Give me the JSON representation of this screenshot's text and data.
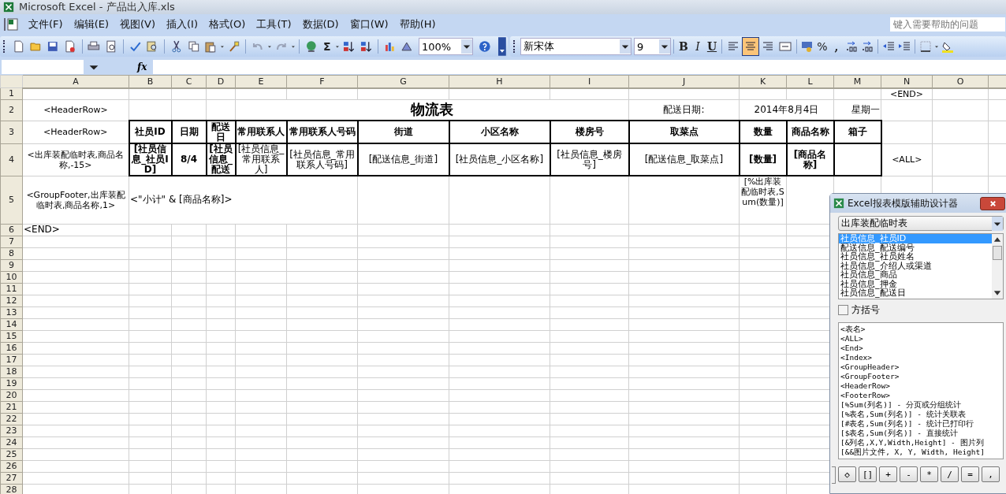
{
  "window": {
    "title": "Microsoft Excel - 产品出入库.xls"
  },
  "menu": [
    "文件(F)",
    "编辑(E)",
    "视图(V)",
    "插入(I)",
    "格式(O)",
    "工具(T)",
    "数据(D)",
    "窗口(W)",
    "帮助(H)"
  ],
  "help_search": {
    "placeholder": "键入需要帮助的问题"
  },
  "standard_toolbar": {
    "sum_label": "Σ",
    "zoom": "100%"
  },
  "formatting_toolbar": {
    "font": "新宋体",
    "size": "9",
    "bold_label": "B",
    "italic_label": "I",
    "underline_label": "U",
    "align_buttons": [
      {
        "selected": false
      },
      {
        "selected": true
      },
      {
        "selected": false
      },
      {
        "selected": false
      }
    ],
    "percent_label": "%",
    "comma_label": ","
  },
  "formula_bar": {
    "fx_label": "fx"
  },
  "sheet": {
    "columns": [
      "A",
      "B",
      "C",
      "D",
      "E",
      "F",
      "G",
      "H",
      "I",
      "J",
      "K",
      "L",
      "M",
      "N",
      "O"
    ],
    "rows": [
      {
        "number": "1",
        "cells": [
          {
            "kind": "empty"
          },
          {
            "kind": "empty"
          },
          {
            "kind": "empty"
          },
          {
            "kind": "empty"
          },
          {
            "kind": "empty"
          },
          {
            "kind": "empty"
          },
          {
            "kind": "empty"
          },
          {
            "kind": "empty"
          },
          {
            "kind": "empty"
          },
          {
            "kind": "empty"
          },
          {
            "kind": "empty"
          },
          {
            "kind": "empty"
          },
          {
            "kind": "empty"
          },
          {
            "kind": "tag",
            "text": "<END>"
          },
          {
            "kind": "empty"
          }
        ]
      },
      {
        "number": "2",
        "cells": [
          {
            "kind": "tag",
            "text": "<HeaderRow>"
          },
          {
            "kind": "empty"
          },
          {
            "kind": "empty"
          },
          {
            "kind": "empty"
          },
          {
            "kind": "title",
            "text": "物流表"
          },
          {
            "kind": "merged"
          },
          {
            "kind": "merged"
          },
          {
            "kind": "merged"
          },
          {
            "kind": "merged"
          },
          {
            "kind": "label",
            "text": "配送日期:"
          },
          {
            "kind": "label",
            "text": "2014年8月4日"
          },
          {
            "kind": "merged"
          },
          {
            "kind": "right",
            "text": "星期一"
          },
          {
            "kind": "empty"
          },
          {
            "kind": "empty"
          }
        ]
      },
      {
        "number": "3",
        "cells": [
          {
            "kind": "tag",
            "text": "<HeaderRow>"
          },
          {
            "kind": "header",
            "text": "社员ID"
          },
          {
            "kind": "header",
            "text": "日期"
          },
          {
            "kind": "header",
            "text": "配送日"
          },
          {
            "kind": "header",
            "text": "常用联系人"
          },
          {
            "kind": "header",
            "text": "常用联系人号码"
          },
          {
            "kind": "header",
            "text": "街道"
          },
          {
            "kind": "header",
            "text": "小区名称"
          },
          {
            "kind": "header",
            "text": "楼房号"
          },
          {
            "kind": "header",
            "text": "取菜点"
          },
          {
            "kind": "header",
            "text": "数量"
          },
          {
            "kind": "header",
            "text": "商品名称"
          },
          {
            "kind": "header",
            "text": "箱子"
          },
          {
            "kind": "empty"
          },
          {
            "kind": "empty"
          }
        ]
      },
      {
        "number": "4",
        "cells": [
          {
            "kind": "tag",
            "text": "<出库装配临时表,商品名称,-15>"
          },
          {
            "kind": "bold_field",
            "text": "[社员信息_社员ID]"
          },
          {
            "kind": "bold_field",
            "text": "8/4"
          },
          {
            "kind": "bold_field",
            "text": "[社员信息_配送"
          },
          {
            "kind": "field",
            "text": "[社员信息_常用联系人]"
          },
          {
            "kind": "field",
            "text": "[社员信息_常用联系人号码]"
          },
          {
            "kind": "field",
            "text": "[配送信息_街道]"
          },
          {
            "kind": "field",
            "text": "[社员信息_小区名称]"
          },
          {
            "kind": "field",
            "text": "[社员信息_楼房号]"
          },
          {
            "kind": "field",
            "text": "[配送信息_取菜点]"
          },
          {
            "kind": "bold_field",
            "text": "[数量]"
          },
          {
            "kind": "bold_field",
            "text": "[商品名称]"
          },
          {
            "kind": "box"
          },
          {
            "kind": "tag",
            "text": "<ALL>"
          },
          {
            "kind": "empty"
          }
        ]
      },
      {
        "number": "5",
        "cells": [
          {
            "kind": "tag",
            "text": "<GroupFooter,出库装配临时表,商品名称,1>"
          },
          {
            "kind": "left",
            "text": "<\"小计\" & [商品名称]>"
          },
          {
            "kind": "merged"
          },
          {
            "kind": "merged"
          },
          {
            "kind": "merged"
          },
          {
            "kind": "merged"
          },
          {
            "kind": "empty"
          },
          {
            "kind": "empty"
          },
          {
            "kind": "empty"
          },
          {
            "kind": "empty"
          },
          {
            "kind": "top",
            "text": "[%出库装配临时表,Sum(数量)]"
          },
          {
            "kind": "empty"
          },
          {
            "kind": "empty"
          },
          {
            "kind": "empty"
          },
          {
            "kind": "empty"
          }
        ]
      },
      {
        "number": "6",
        "cells": [
          {
            "kind": "left",
            "text": "<END>"
          },
          {
            "kind": "empty"
          },
          {
            "kind": "empty"
          },
          {
            "kind": "empty"
          },
          {
            "kind": "empty"
          },
          {
            "kind": "empty"
          },
          {
            "kind": "empty"
          },
          {
            "kind": "empty"
          },
          {
            "kind": "empty"
          },
          {
            "kind": "empty"
          },
          {
            "kind": "empty"
          },
          {
            "kind": "empty"
          },
          {
            "kind": "empty"
          },
          {
            "kind": "empty"
          },
          {
            "kind": "empty"
          }
        ]
      },
      {
        "number": "7"
      },
      {
        "number": "8"
      },
      {
        "number": "9"
      },
      {
        "number": "10"
      },
      {
        "number": "11"
      },
      {
        "number": "12"
      },
      {
        "number": "13"
      },
      {
        "number": "14"
      },
      {
        "number": "15"
      },
      {
        "number": "16"
      },
      {
        "number": "17"
      },
      {
        "number": "18"
      },
      {
        "number": "19"
      },
      {
        "number": "20"
      },
      {
        "number": "21"
      },
      {
        "number": "22"
      },
      {
        "number": "23"
      },
      {
        "number": "24"
      },
      {
        "number": "25"
      },
      {
        "number": "26"
      },
      {
        "number": "27"
      },
      {
        "number": "28"
      }
    ]
  },
  "designer": {
    "title": "Excel报表模版辅助设计器",
    "table_select": "出库装配临时表",
    "fields": [
      {
        "label": "社员信息_社员ID",
        "selected": true
      },
      {
        "label": "配送信息_配送编号",
        "selected": false
      },
      {
        "label": "社员信息_社员姓名",
        "selected": false
      },
      {
        "label": "社员信息_介绍人或渠道",
        "selected": false
      },
      {
        "label": "社员信息_商品",
        "selected": false
      },
      {
        "label": "社员信息_押金",
        "selected": false
      },
      {
        "label": "社员信息_配送日",
        "selected": false
      }
    ],
    "bracket_option": {
      "label": "方括号",
      "checked": false
    },
    "snippets": [
      "<表名>",
      "<ALL>",
      "<End>",
      "<Index>",
      "<GroupHeader>",
      "<GroupFooter>",
      "<HeaderRow>",
      "<FooterRow>",
      "[%Sum(列名)] - 分页或分组统计",
      "[%表名,Sum(列名)] - 统计关联表",
      "[#表名,Sum(列名)] - 统计已打印行",
      "[$表名,Sum(列名)] - 直接统计",
      "[&列名,X,Y,Width,Height] - 图片列",
      "[&&图片文件, X, Y, Width, Height]"
    ],
    "operator_buttons": [
      "◇",
      "[]",
      "+",
      "-",
      "*",
      "/",
      "=",
      ","
    ]
  }
}
